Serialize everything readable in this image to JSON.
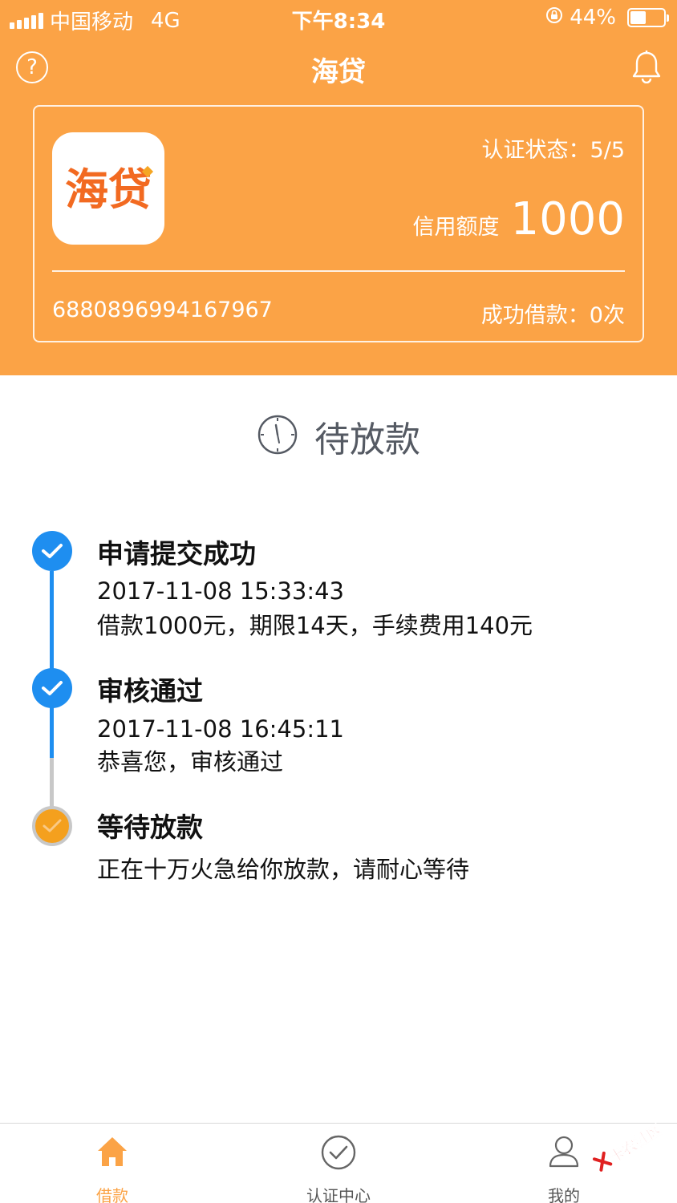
{
  "status_bar": {
    "carrier": "中国移动",
    "network": "4G",
    "time": "下午8:34",
    "battery": "44%",
    "battery_level": 0.44,
    "icons": [
      "signal-icon",
      "orientation-lock-icon",
      "battery-icon"
    ]
  },
  "nav": {
    "title": "海贷",
    "help_icon": "question-icon",
    "bell_icon": "bell-icon"
  },
  "card": {
    "logo_text": "海贷",
    "cert_status": "认证状态：5/5",
    "credit_label": "信用额度",
    "credit_value": "1000",
    "account_no": "6880896994167967",
    "success_loans": "成功借款：0次"
  },
  "loan_status": {
    "icon": "clock-icon",
    "label": "待放款"
  },
  "timeline": [
    {
      "title": "申请提交成功",
      "time": "2017-11-08 15:33:43",
      "detail": "借款1000元，期限14天，手续费用140元",
      "state": "done"
    },
    {
      "title": "审核通过",
      "time": "2017-11-08 16:45:11",
      "detail": "恭喜您，审核通过",
      "state": "done"
    },
    {
      "title": "等待放款",
      "detail": "正在十万火急给你放款，请耐心等待",
      "state": "pending"
    }
  ],
  "tabs": [
    {
      "label": "借款",
      "icon": "home-icon",
      "active": true
    },
    {
      "label": "认证中心",
      "icon": "check-circle-icon",
      "active": false
    },
    {
      "label": "我的",
      "icon": "user-icon",
      "active": false
    }
  ],
  "watermark": "卡农社区",
  "colors": {
    "brand_orange": "#FBA346",
    "timeline_blue": "#1E8EF0",
    "pending_orange": "#F4A01E"
  }
}
